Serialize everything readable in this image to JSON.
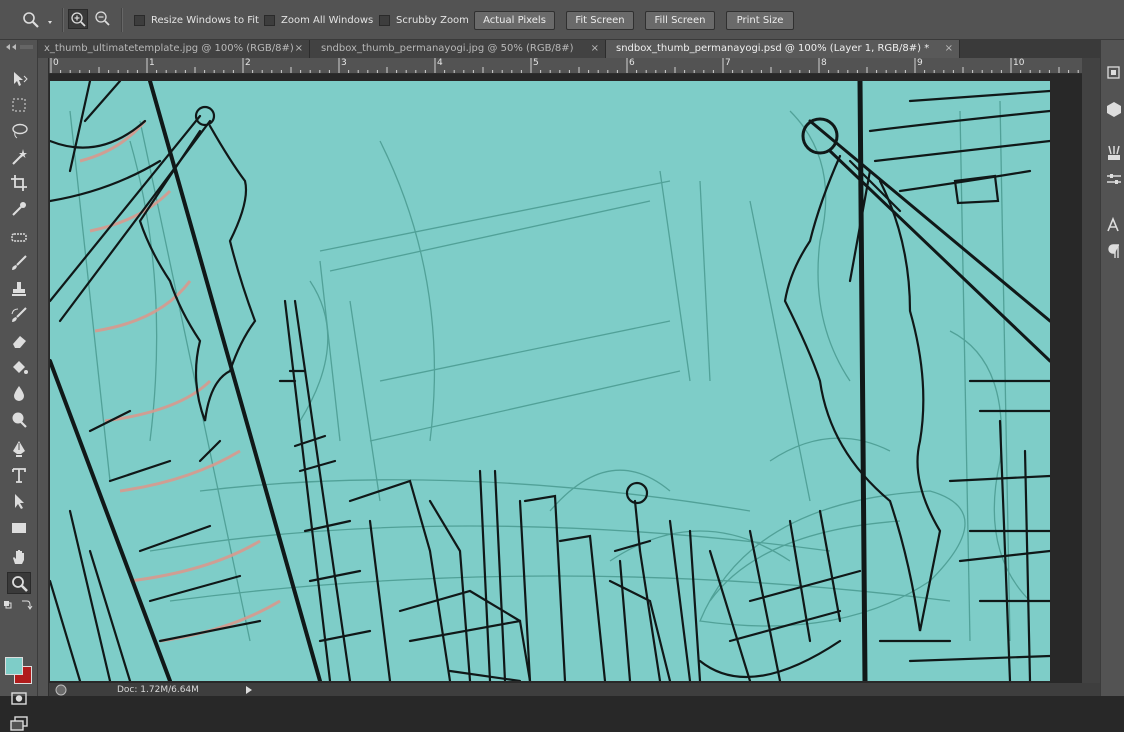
{
  "options_bar": {
    "resize_windows": "Resize Windows to Fit",
    "zoom_all": "Zoom All Windows",
    "scrubby_zoom": "Scrubby Zoom",
    "actual_pixels": "Actual Pixels",
    "fit_screen": "Fit Screen",
    "fill_screen": "Fill Screen",
    "print_size": "Print Size"
  },
  "tabs": [
    {
      "label": "x_thumb_ultimatetemplate.jpg @ 100% (RGB/8#)",
      "close": "×"
    },
    {
      "label": "sndbox_thumb_permanayogi.jpg @ 50% (RGB/8#)",
      "close": "×"
    },
    {
      "label": "sndbox_thumb_permanayogi.psd @ 100% (Layer 1, RGB/8#) *",
      "close": "×"
    }
  ],
  "ruler_numbers": [
    "0",
    "1",
    "2",
    "3",
    "4",
    "5",
    "6",
    "7",
    "8",
    "9",
    "10"
  ],
  "status": {
    "doc": "Doc: 1.72M/6.64M"
  },
  "colors": {
    "foreground": "#7ecdc8",
    "background": "#b01c1c",
    "canvas": "#7ecdc8"
  },
  "tools": [
    "move-icon",
    "marquee-icon",
    "lasso-icon",
    "magic-wand-icon",
    "crop-icon",
    "eyedropper-icon",
    "healing-brush-icon",
    "brush-icon",
    "clone-stamp-icon",
    "history-brush-icon",
    "eraser-icon",
    "paint-bucket-icon",
    "blur-icon",
    "dodge-icon",
    "pen-icon",
    "type-icon",
    "path-selection-icon",
    "rectangle-icon",
    "hand-icon",
    "zoom-icon"
  ]
}
